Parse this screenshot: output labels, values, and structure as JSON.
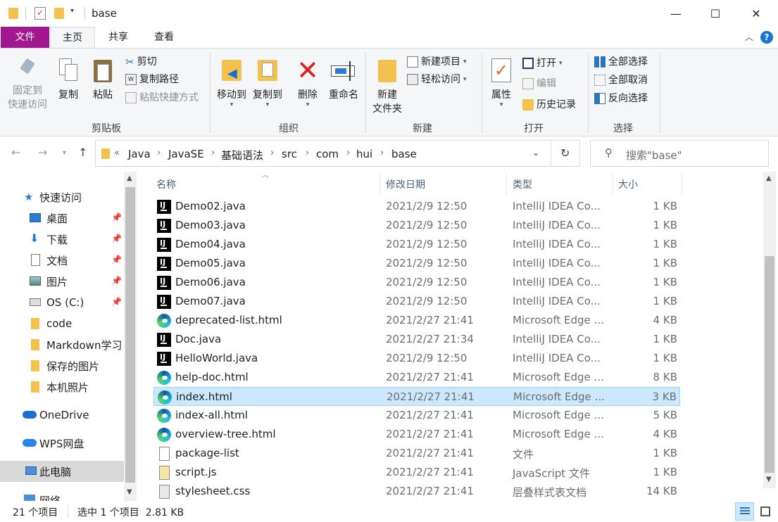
{
  "window": {
    "title": "base",
    "minimize": "—",
    "maximize": "☐",
    "close": "✕"
  },
  "ribbon_tabs": [
    "文件",
    "主页",
    "共享",
    "查看"
  ],
  "ribbon": {
    "clipboard": {
      "pin_quick_access": "固定到\n快速访问",
      "copy": "复制",
      "paste": "粘贴",
      "cut": "剪切",
      "copy_path": "复制路径",
      "paste_shortcut": "粘贴快捷方式",
      "label": "剪贴板"
    },
    "organize": {
      "move_to": "移动到",
      "copy_to": "复制到",
      "delete": "删除",
      "rename": "重命名",
      "label": "组织"
    },
    "new": {
      "new_folder": "新建\n文件夹",
      "new_item": "新建项目",
      "easy_access": "轻松访问",
      "label": "新建"
    },
    "open": {
      "properties": "属性",
      "open": "打开",
      "edit": "编辑",
      "history": "历史记录",
      "label": "打开"
    },
    "select": {
      "select_all": "全部选择",
      "select_none": "全部取消",
      "invert": "反向选择",
      "label": "选择"
    }
  },
  "address": {
    "overflow": "«",
    "crumbs": [
      "Java",
      "JavaSE",
      "基础语法",
      "src",
      "com",
      "hui",
      "base"
    ],
    "search_placeholder": "搜索\"base\""
  },
  "nav": {
    "quick_access": "快速访问",
    "items": [
      {
        "label": "桌面",
        "pinned": true
      },
      {
        "label": "下载",
        "pinned": true
      },
      {
        "label": "文档",
        "pinned": true
      },
      {
        "label": "图片",
        "pinned": true
      },
      {
        "label": "OS (C:)",
        "pinned": true
      },
      {
        "label": "code",
        "pinned": false
      },
      {
        "label": "Markdown学习",
        "pinned": false
      },
      {
        "label": "保存的图片",
        "pinned": false
      },
      {
        "label": "本机照片",
        "pinned": false
      }
    ],
    "onedrive": "OneDrive",
    "wps": "WPS网盘",
    "this_pc": "此电脑",
    "network": "网络"
  },
  "columns": {
    "name": "名称",
    "modified": "修改日期",
    "type": "类型",
    "size": "大小"
  },
  "files": [
    {
      "name": "Demo02.java",
      "date": "2021/2/9 12:50",
      "type": "IntelliJ IDEA Co...",
      "size": "1 KB",
      "icon": "intellij-icon"
    },
    {
      "name": "Demo03.java",
      "date": "2021/2/9 12:50",
      "type": "IntelliJ IDEA Co...",
      "size": "1 KB",
      "icon": "intellij-icon"
    },
    {
      "name": "Demo04.java",
      "date": "2021/2/9 12:50",
      "type": "IntelliJ IDEA Co...",
      "size": "1 KB",
      "icon": "intellij-icon"
    },
    {
      "name": "Demo05.java",
      "date": "2021/2/9 12:50",
      "type": "IntelliJ IDEA Co...",
      "size": "1 KB",
      "icon": "intellij-icon"
    },
    {
      "name": "Demo06.java",
      "date": "2021/2/9 12:50",
      "type": "IntelliJ IDEA Co...",
      "size": "1 KB",
      "icon": "intellij-icon"
    },
    {
      "name": "Demo07.java",
      "date": "2021/2/9 12:50",
      "type": "IntelliJ IDEA Co...",
      "size": "1 KB",
      "icon": "intellij-icon"
    },
    {
      "name": "deprecated-list.html",
      "date": "2021/2/27 21:41",
      "type": "Microsoft Edge ...",
      "size": "4 KB",
      "icon": "edge-icon"
    },
    {
      "name": "Doc.java",
      "date": "2021/2/27 21:34",
      "type": "IntelliJ IDEA Co...",
      "size": "1 KB",
      "icon": "intellij-icon"
    },
    {
      "name": "HelloWorld.java",
      "date": "2021/2/9 12:50",
      "type": "IntelliJ IDEA Co...",
      "size": "1 KB",
      "icon": "intellij-icon"
    },
    {
      "name": "help-doc.html",
      "date": "2021/2/27 21:41",
      "type": "Microsoft Edge ...",
      "size": "8 KB",
      "icon": "edge-icon"
    },
    {
      "name": "index.html",
      "date": "2021/2/27 21:41",
      "type": "Microsoft Edge ...",
      "size": "3 KB",
      "icon": "edge-icon",
      "selected": true
    },
    {
      "name": "index-all.html",
      "date": "2021/2/27 21:41",
      "type": "Microsoft Edge ...",
      "size": "5 KB",
      "icon": "edge-icon"
    },
    {
      "name": "overview-tree.html",
      "date": "2021/2/27 21:41",
      "type": "Microsoft Edge ...",
      "size": "4 KB",
      "icon": "edge-icon"
    },
    {
      "name": "package-list",
      "date": "2021/2/27 21:41",
      "type": "文件",
      "size": "1 KB",
      "icon": "file-icon"
    },
    {
      "name": "script.js",
      "date": "2021/2/27 21:41",
      "type": "JavaScript 文件",
      "size": "1 KB",
      "icon": "js-file-icon"
    },
    {
      "name": "stylesheet.css",
      "date": "2021/2/27 21:41",
      "type": "层叠样式表文档",
      "size": "14 KB",
      "icon": "css-file-icon"
    }
  ],
  "status": {
    "count": "21 个项目",
    "selection": "选中 1 个项目  2.81 KB"
  },
  "colors": {
    "file_tab": "#a1178f",
    "selection": "#cce8ff",
    "selection_border": "#99d1ff"
  }
}
